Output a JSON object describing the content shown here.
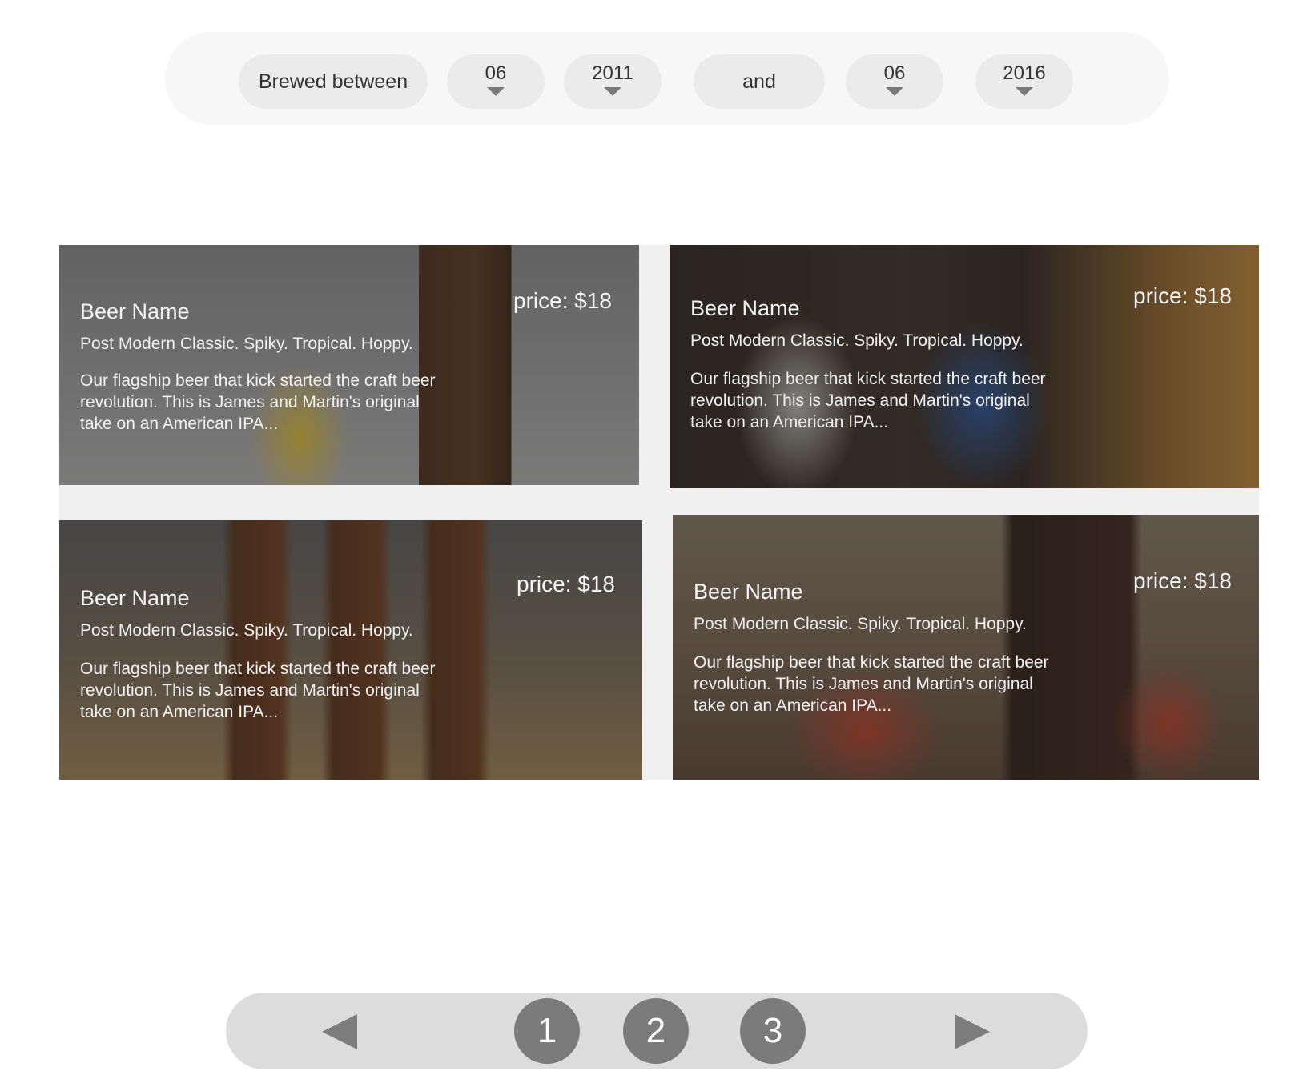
{
  "filter": {
    "label": "Brewed between",
    "from_month": "06",
    "from_year": "2011",
    "and_label": "and",
    "to_month": "06",
    "to_year": "2016"
  },
  "cards": [
    {
      "name": "Beer Name",
      "tagline": "Post Modern Classic. Spiky. Tropical. Hoppy.",
      "description": "Our flagship beer that kick started the craft beer revolution. This is James and Martin's original take on an American IPA...",
      "price": "price: $18"
    },
    {
      "name": "Beer Name",
      "tagline": "Post Modern Classic. Spiky. Tropical. Hoppy.",
      "description": "Our flagship beer that kick started the craft beer revolution. This is James and Martin's original take on an American IPA...",
      "price": "price: $18"
    },
    {
      "name": "Beer Name",
      "tagline": "Post Modern Classic. Spiky. Tropical. Hoppy.",
      "description": "Our flagship beer that kick started the craft beer revolution. This is James and Martin's original take on an American IPA...",
      "price": "price: $18"
    },
    {
      "name": "Beer Name",
      "tagline": "Post Modern Classic. Spiky. Tropical. Hoppy.",
      "description": "Our flagship beer that kick started the craft beer revolution. This is James and Martin's original take on an American IPA...",
      "price": "price: $18"
    }
  ],
  "pagination": {
    "prev_icon": "triangle-left-icon",
    "next_icon": "triangle-right-icon",
    "pages": [
      "1",
      "2",
      "3"
    ]
  }
}
